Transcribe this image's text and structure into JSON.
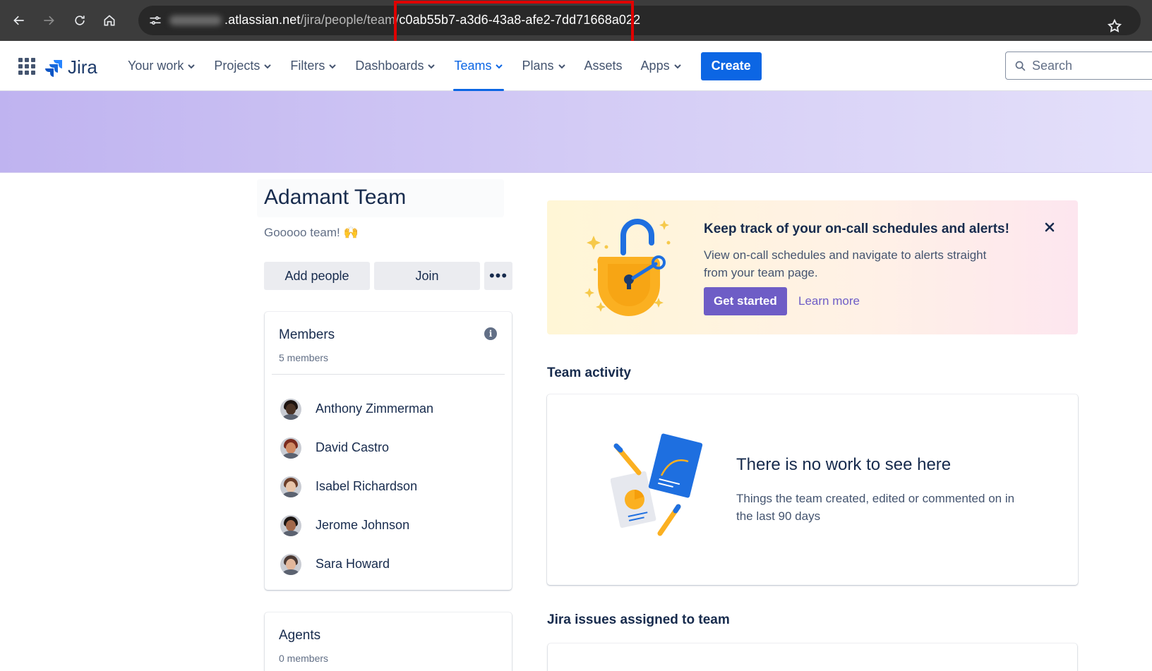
{
  "browser": {
    "address_host": ".atlassian.net",
    "address_path": "/jira/people/team/",
    "address_id": "c0ab55b7-a3d6-43a8-afe2-7dd71668a022"
  },
  "nav": {
    "logo": "Jira",
    "items": [
      {
        "label": "Your work",
        "dropdown": true
      },
      {
        "label": "Projects",
        "dropdown": true
      },
      {
        "label": "Filters",
        "dropdown": true
      },
      {
        "label": "Dashboards",
        "dropdown": true
      },
      {
        "label": "Teams",
        "dropdown": true,
        "active": true
      },
      {
        "label": "Plans",
        "dropdown": true
      },
      {
        "label": "Assets",
        "dropdown": false
      },
      {
        "label": "Apps",
        "dropdown": true
      }
    ],
    "create_label": "Create",
    "search_placeholder": "Search"
  },
  "team": {
    "name": "Adamant Team",
    "description": "Gooooo team! 🙌",
    "add_people_label": "Add people",
    "join_label": "Join",
    "more_label": "•••"
  },
  "members": {
    "title": "Members",
    "count": "5 members",
    "list": [
      {
        "name": "Anthony Zimmerman",
        "skin": "#4a3326",
        "hair": "#1c1310"
      },
      {
        "name": "David Castro",
        "skin": "#d08a64",
        "hair": "#7a2a1e"
      },
      {
        "name": "Isabel Richardson",
        "skin": "#e8c4a8",
        "hair": "#6b3d28"
      },
      {
        "name": "Jerome Johnson",
        "skin": "#a2684a",
        "hair": "#1b1512"
      },
      {
        "name": "Sara Howard",
        "skin": "#e2b79b",
        "hair": "#4b3a34"
      }
    ]
  },
  "agents": {
    "title": "Agents",
    "count": "0 members"
  },
  "promo": {
    "title": "Keep track of your on-call schedules and alerts!",
    "text": "View on-call schedules and navigate to alerts straight from your team page.",
    "cta_label": "Get started",
    "link_label": "Learn more"
  },
  "activity": {
    "heading": "Team activity",
    "empty_title": "There is no work to see here",
    "empty_text": "Things the team created, edited or commented on in the last 90 days"
  },
  "issues": {
    "heading": "Jira issues assigned to team"
  },
  "colors": {
    "brand": "#0c66e4",
    "promo_accent": "#6e5dc6",
    "banner": "#c9c0f3"
  }
}
